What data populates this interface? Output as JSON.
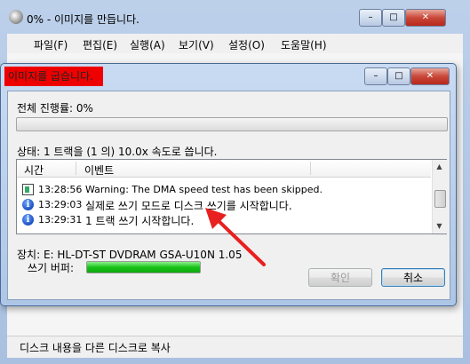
{
  "back_window": {
    "title": "0% - 이미지를 만듭니다.",
    "menu": [
      "파일(F)",
      "편집(E)",
      "실행(A)",
      "보기(V)",
      "설정(O)",
      "도움말(H)"
    ],
    "status_text": "디스크 내용을 다른 디스크로 복사"
  },
  "dialog": {
    "title": "이미지를 굽습니다.",
    "overall_label": "전체 진행률: 0%",
    "overall_progress": 0,
    "status_label": "상태: 1 트랙을 (1 의) 10.0x 속도로 씁니다.",
    "log": {
      "columns": [
        "시간",
        "이벤트"
      ],
      "rows": [
        {
          "icon": "monitor-icon",
          "time": "13:28:56",
          "message": "Warning: The DMA speed test has been skipped."
        },
        {
          "icon": "info-icon",
          "time": "13:29:03",
          "message": "실제로 쓰기 모드로 디스크 쓰기를 시작합니다."
        },
        {
          "icon": "info-icon",
          "time": "13:29:31",
          "message": "1 트랙 쓰기 시작합니다."
        }
      ]
    },
    "device_label": "장치: E: HL-DT-ST DVDRAM GSA-U10N 1.05",
    "buffer_label": "쓰기 버퍼:",
    "buffer_fill": 1.0,
    "ok_button": "확인",
    "cancel_button": "취소"
  },
  "colors": {
    "title_highlight": "#ee0000",
    "arrow": "#e8201f",
    "buffer_fill": "#18c318"
  }
}
